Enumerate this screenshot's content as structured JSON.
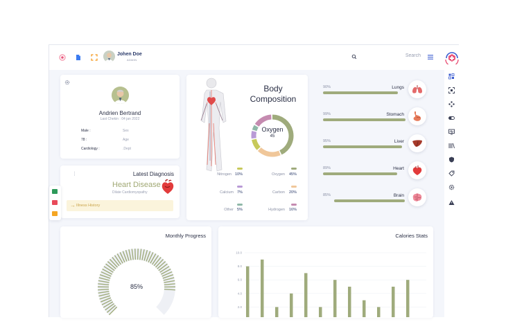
{
  "header": {
    "user_name": "Johen Doe",
    "user_role": "ADMIN",
    "search_placeholder": "Search"
  },
  "icons": {
    "top": [
      "target-icon",
      "document-icon",
      "expand-icon"
    ],
    "sidebar": [
      "grid-icon",
      "scan-icon",
      "nodes-icon",
      "pill-icon",
      "monitor-icon",
      "bars-icon",
      "shield-icon",
      "tag-icon",
      "settings-icon",
      "warning-icon"
    ]
  },
  "patient": {
    "name": "Andrien Bertrand",
    "last_checkin": "Last Chekin : 04 jan 2022",
    "fields": [
      {
        "label": "Male :",
        "value": "Sex"
      },
      {
        "label": "78 :",
        "value": "Age"
      },
      {
        "label": "Cardiology :",
        "value": ".Dept"
      }
    ]
  },
  "diagnosis": {
    "title": "Latest Diagnosis",
    "name": "Heart Disease",
    "subtitle": "Dilate Cardiomyopathy",
    "history_label": "Illness History",
    "menu_glyph": "⋮",
    "arrow_glyph": "→"
  },
  "body_composition": {
    "title_line1": "Body",
    "title_line2": "Composition",
    "center_label": "Oxygen",
    "center_value": "45",
    "elements": [
      {
        "name": "Nitrogen",
        "value": "10%",
        "color": "#c7c95a"
      },
      {
        "name": "Oxygen",
        "value": "45%",
        "color": "#9fab7c"
      },
      {
        "name": "Calcium",
        "value": "7%",
        "color": "#b99ad6"
      },
      {
        "name": "Carbon",
        "value": "20%",
        "color": "#f0c79a"
      },
      {
        "name": "Other",
        "value": "5%",
        "color": "#8fb8a8"
      },
      {
        "name": "Hydrogen",
        "value": "16%",
        "color": "#c58bb0"
      }
    ]
  },
  "organs": [
    {
      "name": "Lungs",
      "percent": "90%",
      "fill": 0.9,
      "icon": "lungs-icon"
    },
    {
      "name": "Stomach",
      "percent": "99%",
      "fill": 0.99,
      "icon": "stomach-icon"
    },
    {
      "name": "Liver",
      "percent": "95%",
      "fill": 0.95,
      "icon": "liver-icon"
    },
    {
      "name": "Heart",
      "percent": "89%",
      "fill": 0.89,
      "icon": "heart-icon"
    },
    {
      "name": "Brain",
      "percent": "85%",
      "fill": 0.85,
      "icon": "brain-icon"
    }
  ],
  "monthly_progress": {
    "title": "Monthly Progress",
    "value_label": "85%",
    "value": 0.85
  },
  "calories": {
    "title": "Calories Stats"
  },
  "chart_data": {
    "type": "bar",
    "title": "Calories Stats",
    "yticks": [
      "10.0",
      "8.0",
      "6.0",
      "4.0",
      "2.0"
    ],
    "ylim": [
      0,
      10
    ],
    "values": [
      8,
      9,
      2,
      4,
      7,
      2,
      6,
      5,
      3,
      2,
      5,
      6
    ],
    "grid": true,
    "colors": {
      "bar": "#9fab7c"
    }
  },
  "colors": {
    "accent": "#9fab7c",
    "diagnosis": "#a0a874",
    "history": "#c9a44a",
    "heading": "#2a3a6a"
  }
}
